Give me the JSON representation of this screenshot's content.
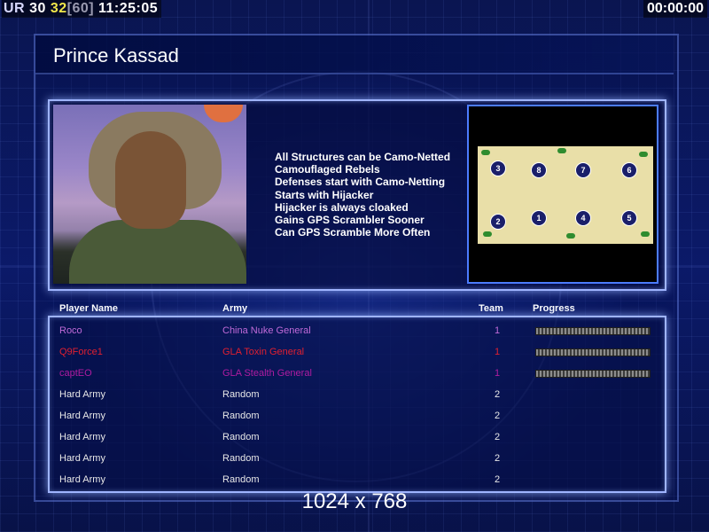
{
  "hud": {
    "ur_label": "UR",
    "fps_current": "30",
    "fps_other": "32",
    "fps_limit": "[60]",
    "clock": "11:25:05",
    "timer": "00:00:00"
  },
  "title": "Prince Kassad",
  "traits": [
    "All Structures can be Camo-Netted",
    "Camouflaged Rebels",
    "Defenses start with Camo-Netting",
    "Starts with Hijacker",
    "Hijacker is always cloaked",
    "Gains GPS Scrambler Sooner",
    "Can GPS Scramble More Often"
  ],
  "minimap": {
    "slots": [
      "3",
      "8",
      "7",
      "6",
      "2",
      "1",
      "4",
      "5"
    ]
  },
  "table": {
    "headers": {
      "player": "Player Name",
      "army": "Army",
      "team": "Team",
      "progress": "Progress"
    },
    "rows": [
      {
        "name": "Roco",
        "army": "China Nuke General",
        "team": "1",
        "color": "#c06ad8",
        "progress": 1
      },
      {
        "name": "Q9Force1",
        "army": "GLA Toxin General",
        "team": "1",
        "color": "#e02030",
        "progress": 1
      },
      {
        "name": "captEO",
        "army": "GLA Stealth General",
        "team": "1",
        "color": "#b01ca0",
        "progress": 1
      },
      {
        "name": "Hard Army",
        "army": "Random",
        "team": "2",
        "color": "#e8e8e8"
      },
      {
        "name": "Hard Army",
        "army": "Random",
        "team": "2",
        "color": "#e8e8e8"
      },
      {
        "name": "Hard Army",
        "army": "Random",
        "team": "2",
        "color": "#e8e8e8"
      },
      {
        "name": "Hard Army",
        "army": "Random",
        "team": "2",
        "color": "#e8e8e8"
      },
      {
        "name": "Hard Army",
        "army": "Random",
        "team": "2",
        "color": "#e8e8e8"
      }
    ]
  },
  "resolution": "1024 x 768"
}
